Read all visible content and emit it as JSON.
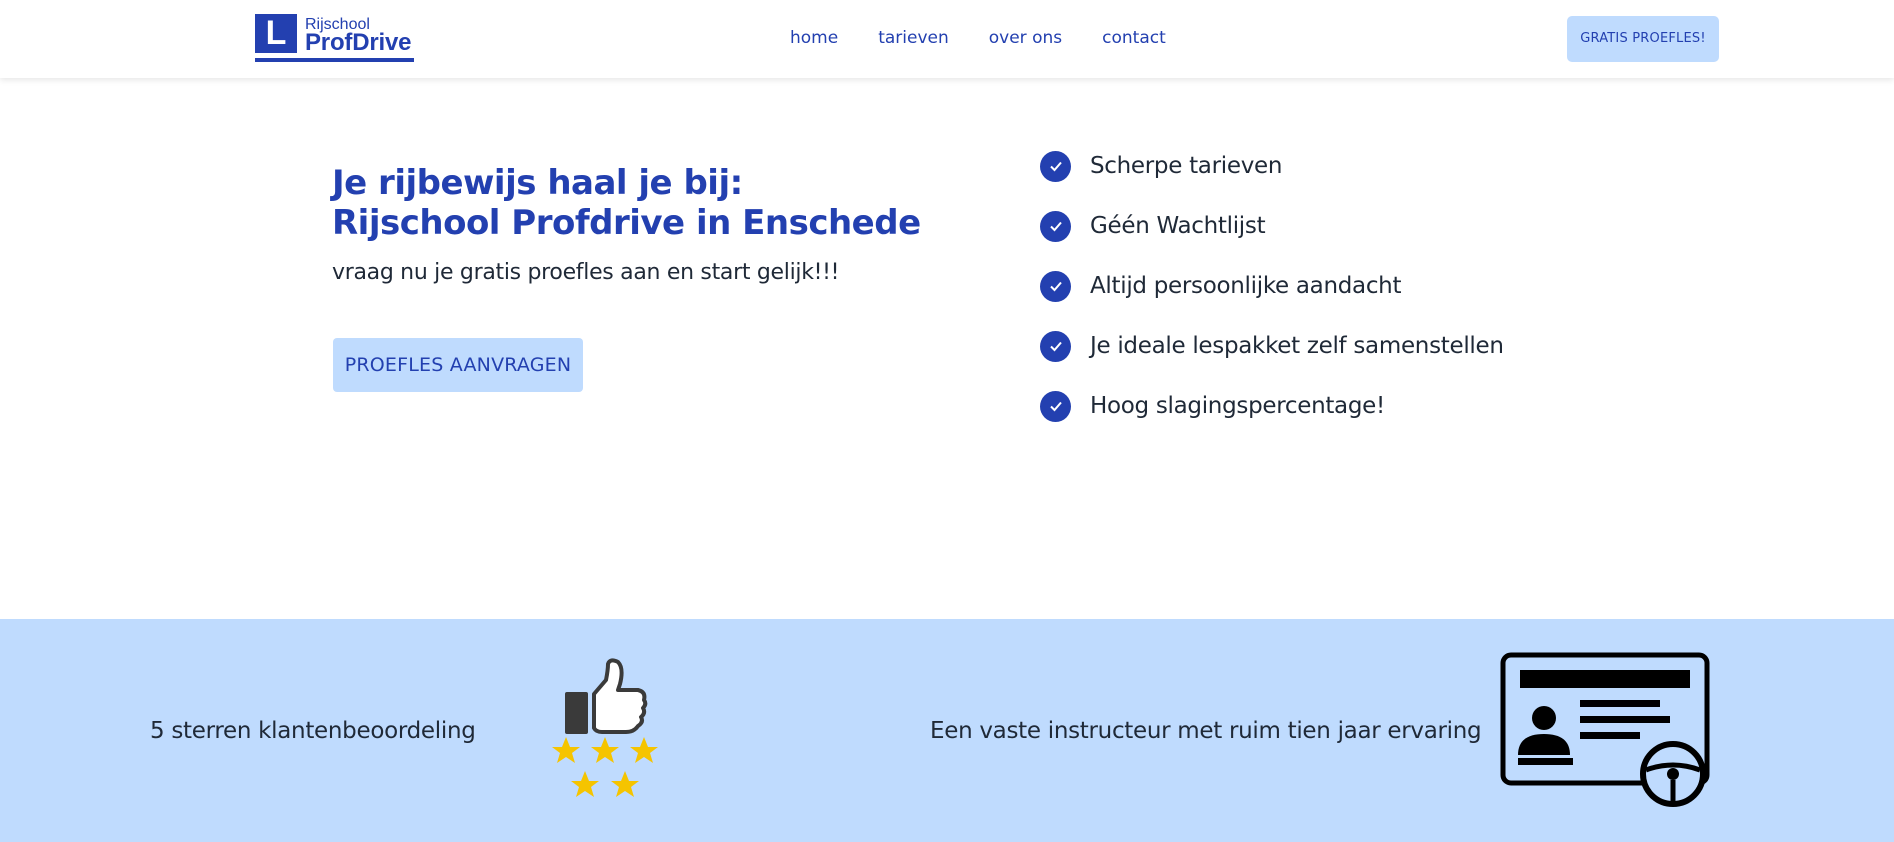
{
  "brand": {
    "logo_letter": "L",
    "logo_small": "Rijschool",
    "logo_big": "ProfDrive",
    "color": "#2340b0"
  },
  "nav": {
    "items": [
      {
        "label": "home"
      },
      {
        "label": "tarieven"
      },
      {
        "label": "over ons"
      },
      {
        "label": "contact"
      }
    ]
  },
  "header_cta": "GRATIS PROEFLES!",
  "hero": {
    "title_line1": "Je rijbewijs haal je bij:",
    "title_line2": "Rijschool Profdrive in Enschede",
    "subtitle": "vraag nu je gratis proefles aan en start gelijk!!!",
    "button": "PROEFLES AANVRAGEN"
  },
  "features": [
    "Scherpe tarieven",
    "Géén Wachtlijst",
    "Altijd persoonlijke aandacht",
    "Je ideale lespakket zelf samenstellen",
    "Hoog slagingspercentage!"
  ],
  "band": {
    "background": "#bfdbfe",
    "text_left": "5 sterren klantenbeoordeling",
    "text_right": "Een vaste instructeur met ruim tien jaar ervaring",
    "icon_left": "thumbs-up-stars-icon",
    "icon_right": "driving-license-icon",
    "star_color": "#f5c400"
  }
}
